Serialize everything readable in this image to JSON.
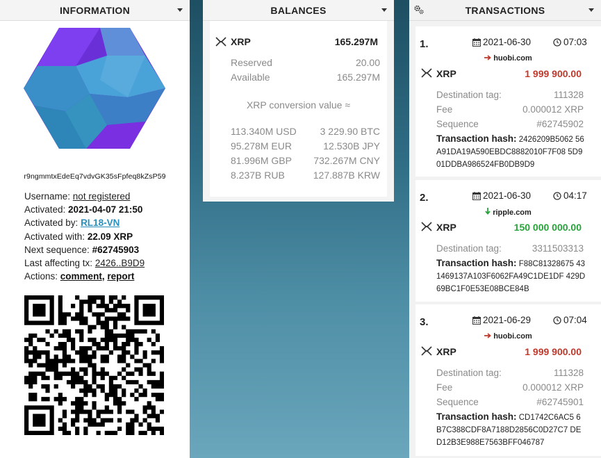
{
  "information": {
    "title": "INFORMATION",
    "address": "r9ngmmtxEdeEq7vdvGK35sFpfeq8kZsP59",
    "username_label": "Username:",
    "username_value": "not registered",
    "activated_label": "Activated:",
    "activated_value": "2021-04-07 21:50",
    "activated_by_label": "Activated by:",
    "activated_by_value": "RL18-VN",
    "activated_with_label": "Activated with:",
    "activated_with_value": "22.09 XRP",
    "next_sequence_label": "Next sequence:",
    "next_sequence_value": "#62745903",
    "last_tx_label": "Last affecting tx:",
    "last_tx_value": "2426..B9D9",
    "actions_label": "Actions:",
    "action_comment": "comment",
    "action_separator": ",",
    "action_report": "report"
  },
  "balances": {
    "title": "BALANCES",
    "currency": "XRP",
    "total": "165.297M",
    "reserved_label": "Reserved",
    "reserved_value": "20.00",
    "available_label": "Available",
    "available_value": "165.297M",
    "conversion_title": "XRP conversion value ≈",
    "conversions": [
      {
        "left": "113.340M USD",
        "right": "3 229.90 BTC"
      },
      {
        "left": "95.278M EUR",
        "right": "12.530B JPY"
      },
      {
        "left": "81.996M GBP",
        "right": "732.267M CNY"
      },
      {
        "left": "8.237B RUB",
        "right": "127.887B KRW"
      }
    ]
  },
  "transactions": {
    "title": "TRANSACTIONS",
    "items": [
      {
        "num": "1.",
        "date": "2021-06-30",
        "time": "07:03",
        "source": "huobi.com",
        "direction": "out",
        "currency": "XRP",
        "amount": "1 999 900.00",
        "dest_tag_label": "Destination tag:",
        "dest_tag": "111328",
        "fee_label": "Fee",
        "fee": "0.000012 XRP",
        "seq_label": "Sequence",
        "seq": "#62745902",
        "hash_label": "Transaction hash:",
        "hash": "2426209B5062 56A91DA19A590EBDC8882010F7F08 5D901DDBA986524FB0DB9D9"
      },
      {
        "num": "2.",
        "date": "2021-06-30",
        "time": "04:17",
        "source": "ripple.com",
        "direction": "in",
        "currency": "XRP",
        "amount": "150 000 000.00",
        "dest_tag_label": "Destination tag:",
        "dest_tag": "3311503313",
        "hash_label": "Transaction hash:",
        "hash": "F88C81328675 431469137A103F6062FA49C1DE1DF 429D69BC1F0E53E08BCE84B"
      },
      {
        "num": "3.",
        "date": "2021-06-29",
        "time": "07:04",
        "source": "huobi.com",
        "direction": "out",
        "currency": "XRP",
        "amount": "1 999 900.00",
        "dest_tag_label": "Destination tag:",
        "dest_tag": "111328",
        "fee_label": "Fee",
        "fee": "0.000012 XRP",
        "seq_label": "Sequence",
        "seq": "#62745901",
        "hash_label": "Transaction hash:",
        "hash": "CD1742C6AC5 6B7C388CDF8A7188D2856C0D27C7 DED12B3E988E7563BFF046787"
      }
    ]
  },
  "icons": {
    "xrp": "xrp-logo-icon",
    "calendar": "calendar-icon",
    "clock": "clock-icon",
    "arrow_out": "arrow-right-icon",
    "arrow_in": "arrow-down-icon",
    "gears": "gears-icon",
    "caret": "caret-down-icon"
  },
  "colors": {
    "outgoing": "#c0392b",
    "incoming": "#27a33a",
    "link": "#2a8fbd"
  }
}
